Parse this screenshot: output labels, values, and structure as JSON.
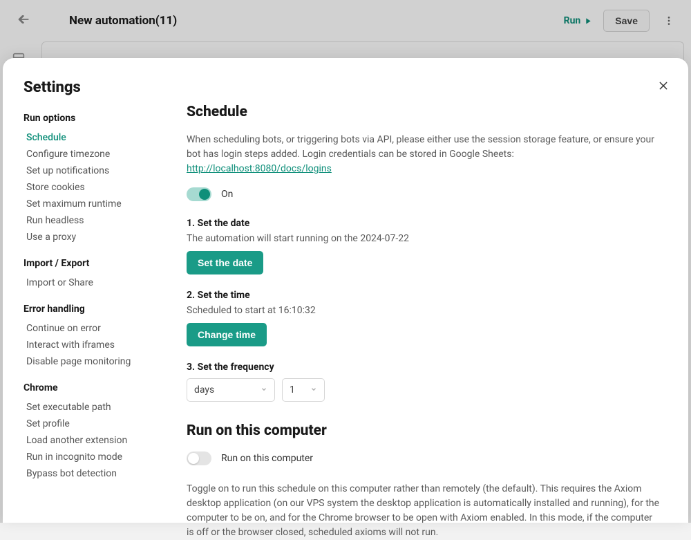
{
  "header": {
    "title": "New automation(11)",
    "run_label": "Run",
    "save_label": "Save"
  },
  "modal": {
    "title": "Settings",
    "nav": {
      "run_options": {
        "title": "Run options",
        "items": [
          "Schedule",
          "Configure timezone",
          "Set up notifications",
          "Store cookies",
          "Set maximum runtime",
          "Run headless",
          "Use a proxy"
        ]
      },
      "import_export": {
        "title": "Import / Export",
        "items": [
          "Import or Share"
        ]
      },
      "error_handling": {
        "title": "Error handling",
        "items": [
          "Continue on error",
          "Interact with iframes",
          "Disable page monitoring"
        ]
      },
      "chrome": {
        "title": "Chrome",
        "items": [
          "Set executable path",
          "Set profile",
          "Load another extension",
          "Run in incognito mode",
          "Bypass bot detection"
        ]
      }
    }
  },
  "schedule": {
    "title": "Schedule",
    "desc_prefix": "When scheduling bots, or triggering bots via API, please either use the session storage feature, or ensure your bot has login steps added. Login credentials can be stored in Google Sheets: ",
    "link": "http://localhost:8080/docs/logins",
    "toggle_label": "On",
    "step1_title": "1. Set the date",
    "step1_desc": "The automation will start running on the 2024-07-22",
    "step1_btn": "Set the date",
    "step2_title": "2. Set the time",
    "step2_desc": "Scheduled to start at 16:10:32",
    "step2_btn": "Change time",
    "step3_title": "3. Set the frequency",
    "freq_unit": "days",
    "freq_value": "1"
  },
  "run_computer": {
    "title": "Run on this computer",
    "toggle_label": "Run on this computer",
    "desc": "Toggle on to run this schedule on this computer rather than remotely (the default). This requires the Axiom desktop application (on our VPS system the desktop application is automatically installed and running), for the computer to be on, and for the Chrome browser to be open with Axiom enabled. In this mode, if the computer is off or the browser closed, scheduled axioms will not run."
  }
}
